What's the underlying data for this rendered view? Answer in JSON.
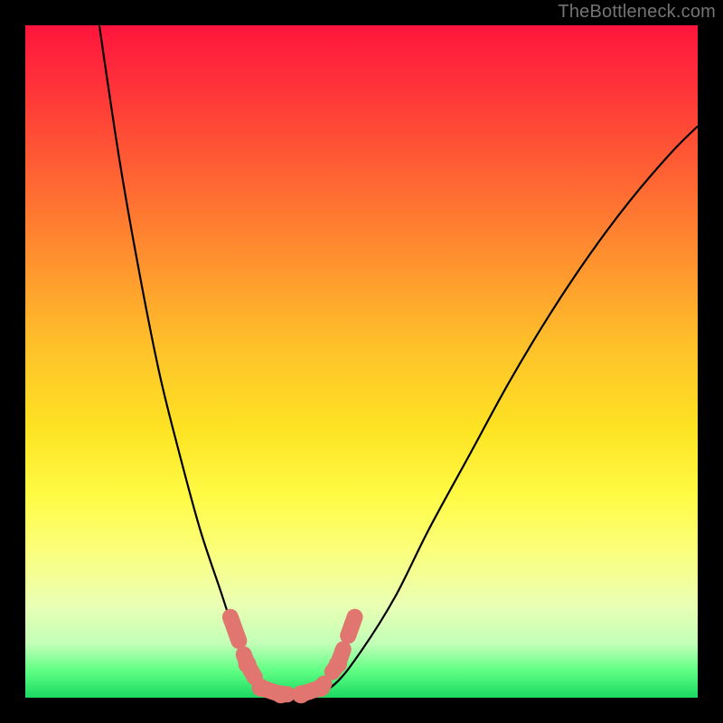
{
  "watermark": "TheBottleneck.com",
  "chart_data": {
    "type": "line",
    "title": "",
    "xlabel": "",
    "ylabel": "",
    "xlim": [
      0,
      100
    ],
    "ylim": [
      0,
      100
    ],
    "series": [
      {
        "name": "bottleneck-curve",
        "x": [
          11,
          14,
          17,
          20,
          23,
          26,
          29,
          31,
          33,
          35,
          38,
          42,
          46,
          50,
          55,
          60,
          66,
          72,
          78,
          84,
          90,
          96,
          100
        ],
        "y": [
          100,
          80,
          63,
          48,
          36,
          25,
          16,
          10,
          5,
          2,
          0,
          0,
          2,
          7,
          15,
          25,
          36,
          47,
          57,
          66,
          74,
          81,
          85
        ]
      }
    ],
    "markers": {
      "name": "highlight-dots",
      "points": [
        {
          "x": 30.5,
          "y": 12
        },
        {
          "x": 33,
          "y": 5
        },
        {
          "x": 35,
          "y": 1.5
        },
        {
          "x": 38,
          "y": 0.5
        },
        {
          "x": 41,
          "y": 0.5
        },
        {
          "x": 44,
          "y": 1.5
        },
        {
          "x": 46.5,
          "y": 5
        },
        {
          "x": 49,
          "y": 12
        }
      ]
    },
    "colors": {
      "curve": "#000000",
      "marker": "#e0766f",
      "gradient_top": "#ff153d",
      "gradient_bottom": "#1bd961"
    }
  }
}
